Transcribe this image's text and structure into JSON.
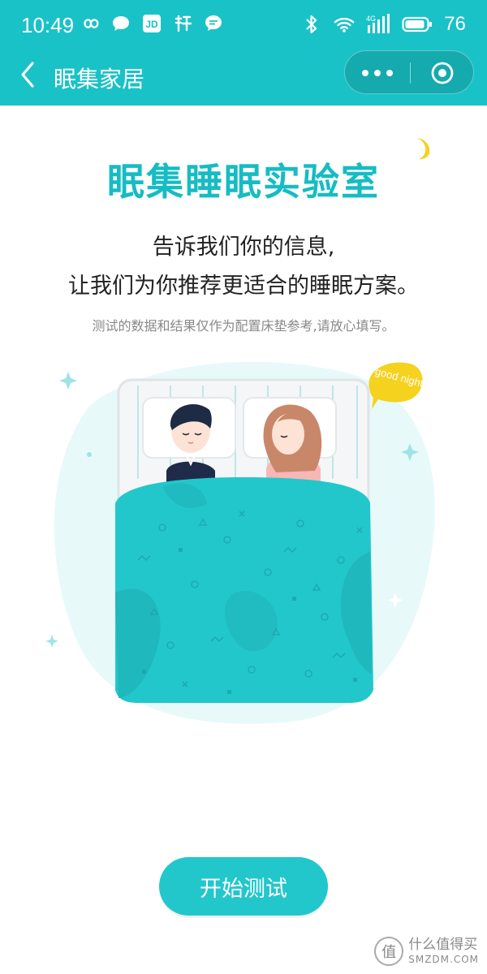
{
  "status_bar": {
    "time": "10:49",
    "battery": "76",
    "network": "4G",
    "left_icons": [
      "infinity-icon",
      "chat-bubble-icon",
      "jd-app-icon",
      "taobao-icon",
      "message-icon"
    ],
    "right_icons": [
      "bluetooth-icon",
      "wifi-icon",
      "signal-icon",
      "battery-icon"
    ]
  },
  "nav": {
    "title": "眠集家居",
    "back_icon": "chevron-left-icon",
    "more_icon": "more-dots-icon",
    "close_icon": "target-close-icon"
  },
  "main": {
    "heading": "眠集睡眠实验室",
    "intro_line1": "告诉我们你的信息,",
    "intro_line2": "让我们为你推荐更适合的睡眠方案。",
    "note": "测试的数据和结果仅作为配置床垫参考,请放心填写。",
    "bubble_text": "good night",
    "start_button": "开始测试"
  },
  "watermark": {
    "logo_char": "值",
    "line1": "什么值得买",
    "line2": "SMZDM.COM"
  },
  "colors": {
    "brand": "#19c2c7",
    "button": "#22c7cc",
    "blanket": "#22c7cc",
    "bubble": "#f4d21e"
  }
}
